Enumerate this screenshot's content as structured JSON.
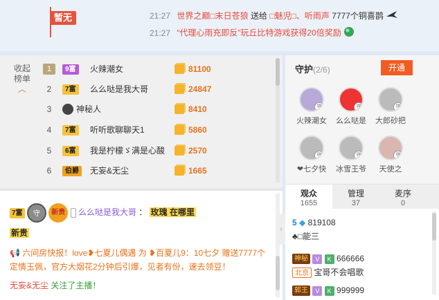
{
  "banner": {
    "flag_label": "暂无",
    "line1": {
      "time": "21:27",
      "text_red": "世界之巅□末日苍狼",
      "verb": "送给",
      "target": "□魅児□、听雨声",
      "gift": "7777个铜喜鹊"
    },
    "line2": {
      "time": "21:27",
      "text": "“代理心雨充即反”玩丘比特游戏获得20倍奖励"
    }
  },
  "rank": {
    "collapse_label": "收起\n榜单",
    "collapse_l1": "收起",
    "collapse_l2": "榜单",
    "rows": [
      {
        "num": "1",
        "badge": "9富",
        "badge_color": "#b65ad8",
        "name": "火辣潮女",
        "score": "81100"
      },
      {
        "num": "2",
        "badge": "7富",
        "badge_color": "#f5c23b",
        "name": "么么哒是我大哥",
        "score": "24847"
      },
      {
        "num": "3",
        "badge": "",
        "badge_color": "",
        "name": "神秘人",
        "score": "8410"
      },
      {
        "num": "4",
        "badge": "7富",
        "badge_color": "#f5c23b",
        "name": "听听歌聊聊天1",
        "score": "5860"
      },
      {
        "num": "5",
        "badge": "6富",
        "badge_color": "#f5c23b",
        "name": "我是柠檬ゞ满是心酸",
        "score": "2570"
      },
      {
        "num": "6",
        "badge": "伯爵",
        "badge_color": "#f0a020",
        "name": "无妄&无尘",
        "score": "1665"
      }
    ]
  },
  "chat": {
    "msg1": {
      "tag": "7富",
      "badge2": "守",
      "badge3": "新贵",
      "user": "么么哒是我大哥",
      "sep": "：",
      "highlight": "玫瑰 在哪里",
      "line2": "新贵"
    },
    "msg2": {
      "prefix": "六间房快报！",
      "body": "love❥七夏儿偶遇 为 ❥百夏儿9：10七夕 赠送7777个定情玉佩，官方大烟花2分钟后引爆，见者有份，速去领豆！"
    },
    "msg3": {
      "user": "无妄&无尘",
      "action": "关注了主播！"
    }
  },
  "guard": {
    "title": "守护",
    "count": "(2/6)",
    "open_label": "开通",
    "members": [
      {
        "name": "火辣潮女"
      },
      {
        "name": "么么哒是"
      },
      {
        "name": "大郎砂把"
      },
      {
        "name": "❤七夕快"
      },
      {
        "name": "冰雪王爷"
      },
      {
        "name": "天使之"
      }
    ]
  },
  "tabs": [
    {
      "label": "观众",
      "count": "1655"
    },
    {
      "label": "管理",
      "count": "37"
    },
    {
      "label": "麦序",
      "count": "0"
    }
  ],
  "audience": [
    {
      "level": "5",
      "name": "819108"
    },
    {
      "level": "",
      "name": "♣□能三"
    },
    {
      "level": "神秘",
      "name": "666666"
    },
    {
      "level": "北京",
      "name": "宝哥不会唱歌"
    },
    {
      "level": "郭王",
      "name": "999999"
    }
  ]
}
